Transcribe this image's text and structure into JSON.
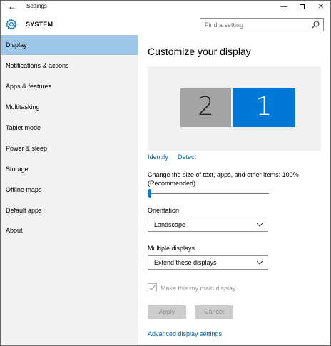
{
  "window": {
    "title": "Settings",
    "back_glyph": "←",
    "minimize_glyph": "—",
    "close_glyph": "✕"
  },
  "header": {
    "section": "SYSTEM",
    "icon": "gear-icon",
    "search_placeholder": "Find a setting"
  },
  "sidebar": {
    "items": [
      {
        "label": "Display",
        "active": true
      },
      {
        "label": "Notifications & actions",
        "active": false
      },
      {
        "label": "Apps & features",
        "active": false
      },
      {
        "label": "Multitasking",
        "active": false
      },
      {
        "label": "Tablet mode",
        "active": false
      },
      {
        "label": "Power & sleep",
        "active": false
      },
      {
        "label": "Storage",
        "active": false
      },
      {
        "label": "Offline maps",
        "active": false
      },
      {
        "label": "Default apps",
        "active": false
      },
      {
        "label": "About",
        "active": false
      }
    ]
  },
  "main": {
    "heading": "Customize your display",
    "monitors": [
      {
        "number": "2",
        "selected": false
      },
      {
        "number": "1",
        "selected": true
      }
    ],
    "identify_link": "Identify",
    "detect_link": "Detect",
    "scale_label_line1": "Change the size of text, apps, and other items: 100%",
    "scale_label_line2": "(Recommended)",
    "scale_value_fraction": 0.0,
    "orientation_label": "Orientation",
    "orientation_value": "Landscape",
    "multiple_displays_label": "Multiple displays",
    "multiple_displays_value": "Extend these displays",
    "main_display_checkbox": "Make this my main display",
    "main_display_checked": true,
    "apply_button": "Apply",
    "cancel_button": "Cancel",
    "advanced_link": "Advanced display settings"
  },
  "colors": {
    "accent": "#0078d7",
    "nav_active": "#9ec6e6",
    "sidebar_bg": "#f2f2f2",
    "link": "#0063b1"
  }
}
